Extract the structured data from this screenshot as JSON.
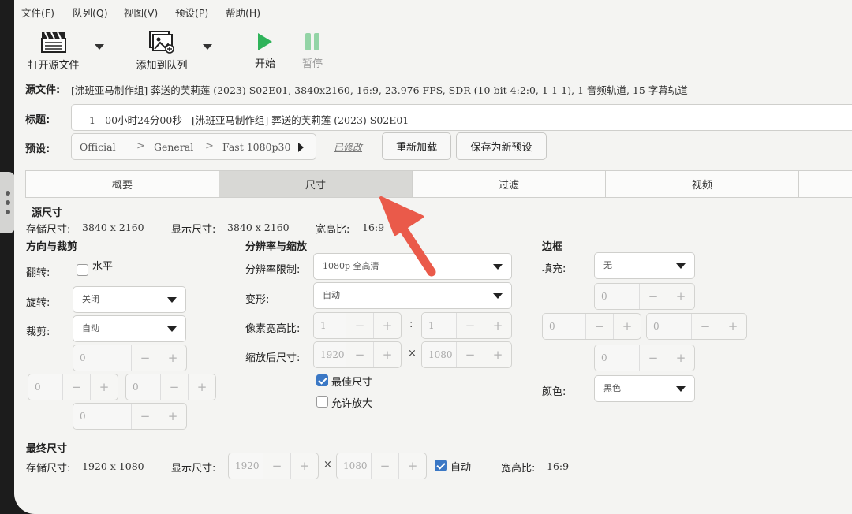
{
  "menu": [
    "文件(F)",
    "队列(Q)",
    "视图(V)",
    "预设(P)",
    "帮助(H)"
  ],
  "toolbar": {
    "open_source": "打开源文件",
    "add_to_queue": "添加到队列",
    "start": "开始",
    "pause": "暂停"
  },
  "source": {
    "label": "源文件:",
    "value": "[沸班亚马制作组] 葬送的芙莉莲 (2023) S02E01, 3840x2160, 16:9, 23.976 FPS, SDR (10-bit 4:2:0, 1-1-1), 1 音频轨道, 15 字幕轨道"
  },
  "title": {
    "label": "标题:",
    "value": "1 - 00小时24分00秒 - [沸班亚马制作组] 葬送的芙莉莲 (2023) S02E01"
  },
  "preset": {
    "label": "预设:",
    "path": [
      "Official",
      "General",
      "Fast 1080p30"
    ],
    "modified": "已修改",
    "reload": "重新加载",
    "save_new": "保存为新预设"
  },
  "tabs": [
    "概要",
    "尺寸",
    "过滤",
    "视频"
  ],
  "active_tab": "尺寸",
  "source_size": {
    "heading": "源尺寸",
    "storage_label": "存储尺寸:",
    "storage_value": "3840 x 2160",
    "display_label": "显示尺寸:",
    "display_value": "3840 x 2160",
    "aspect_label": "宽高比:",
    "aspect_value": "16:9"
  },
  "orientation": {
    "heading": "方向与裁剪",
    "flip_label": "翻转:",
    "flip_option": "水平",
    "rotate_label": "旋转:",
    "rotate_value": "关闭",
    "crop_label": "裁剪:",
    "crop_value": "自动",
    "crop_top": "0",
    "crop_left": "0",
    "crop_right": "0",
    "crop_bottom": "0"
  },
  "resolution": {
    "heading": "分辨率与缩放",
    "limit_label": "分辨率限制:",
    "limit_value": "1080p 全高清",
    "anamorphic_label": "变形:",
    "anamorphic_value": "自动",
    "par_label": "像素宽高比:",
    "par_w": "1",
    "par_h": "1",
    "par_sep": ":",
    "scaled_label": "缩放后尺寸:",
    "scaled_w": "1920",
    "scaled_h": "1080",
    "scaled_sep": "×",
    "optimal_label": "最佳尺寸",
    "optimal_checked": true,
    "upscale_label": "允许放大",
    "upscale_checked": false
  },
  "border": {
    "heading": "边框",
    "fill_label": "填充:",
    "fill_value": "无",
    "top": "0",
    "left": "0",
    "right": "0",
    "bottom": "0",
    "color_label": "颜色:",
    "color_value": "黑色"
  },
  "final_size": {
    "heading": "最终尺寸",
    "storage_label": "存储尺寸:",
    "storage_value": "1920 x 1080",
    "display_label": "显示尺寸:",
    "display_w": "1920",
    "display_h": "1080",
    "sep": "×",
    "auto_label": "自动",
    "auto_checked": true,
    "aspect_label": "宽高比:",
    "aspect_value": "16:9"
  },
  "icons": {
    "open_source": "clapperboard-icon",
    "add_to_queue": "image-add-icon",
    "start": "play-icon",
    "pause": "pause-icon",
    "annotation": "red-arrow-annotation"
  },
  "colors": {
    "start_green": "#2fb35a",
    "pause_green_disabled": "#93d4a6",
    "arrow_red": "#ea5a4a",
    "check_blue": "#3b78c5"
  }
}
